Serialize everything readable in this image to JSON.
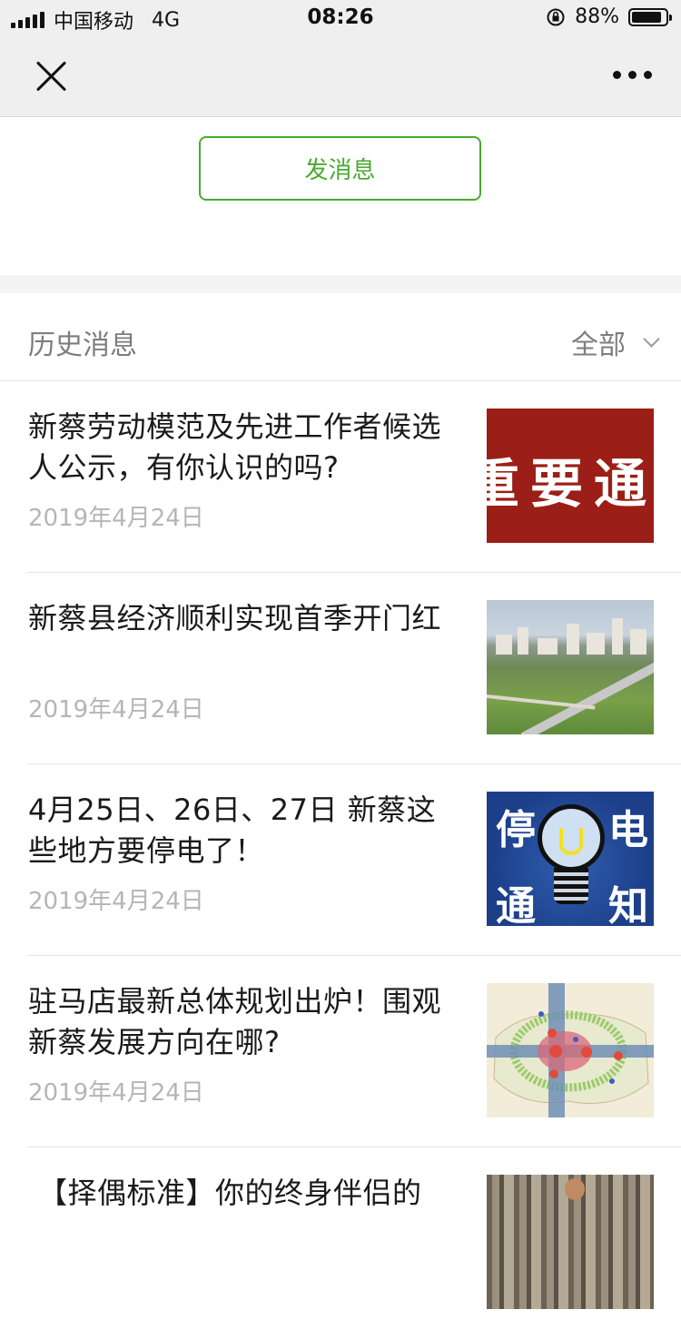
{
  "status_bar": {
    "carrier": "中国移动",
    "network": "4G",
    "time": "08:26",
    "battery": "88%",
    "battery_level": 0.88
  },
  "nav": {
    "close_icon": "close-icon",
    "more_icon": "more-icon"
  },
  "send_message": {
    "label": "发消息",
    "color": "#4aa931"
  },
  "history": {
    "title": "历史消息",
    "filter_label": "全部"
  },
  "articles": [
    {
      "title": "新蔡劳动模范及先进工作者候选人公示，有你认识的吗?",
      "date": "2019年4月24日",
      "thumb_text": "重要通知"
    },
    {
      "title": "新蔡县经济顺利实现首季开门红",
      "date": "2019年4月24日"
    },
    {
      "title": "4月25日、26日、27日 新蔡这些地方要停电了！",
      "date": "2019年4月24日",
      "thumb_text": [
        "停",
        "电",
        "通",
        "知"
      ]
    },
    {
      "title": "驻马店最新总体规划出炉！围观新蔡发展方向在哪?",
      "date": "2019年4月24日"
    },
    {
      "title": "【择偶标准】你的终身伴侣的",
      "date": ""
    }
  ]
}
